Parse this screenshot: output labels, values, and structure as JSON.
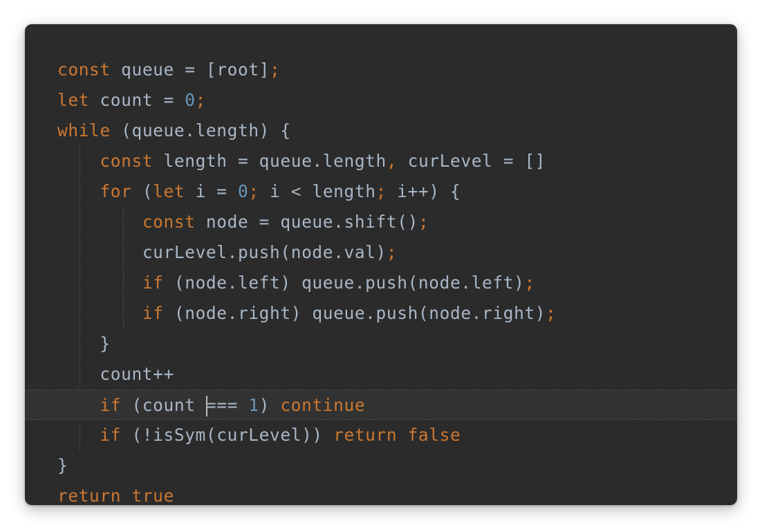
{
  "editor": {
    "lines": [
      {
        "indent": 0,
        "tokens": [
          {
            "t": "k",
            "v": "const"
          },
          {
            "t": "p",
            "v": " queue = [root]"
          },
          {
            "t": "k",
            "v": ";"
          }
        ]
      },
      {
        "indent": 0,
        "tokens": [
          {
            "t": "k",
            "v": "let"
          },
          {
            "t": "p",
            "v": " count = "
          },
          {
            "t": "n",
            "v": "0"
          },
          {
            "t": "k",
            "v": ";"
          }
        ]
      },
      {
        "indent": 0,
        "tokens": [
          {
            "t": "k",
            "v": "while"
          },
          {
            "t": "p",
            "v": " (queue.length) {"
          }
        ]
      },
      {
        "indent": 1,
        "tokens": [
          {
            "t": "k",
            "v": "const"
          },
          {
            "t": "p",
            "v": " length = queue.length"
          },
          {
            "t": "k",
            "v": ","
          },
          {
            "t": "p",
            "v": " curLevel = []"
          }
        ]
      },
      {
        "indent": 1,
        "tokens": [
          {
            "t": "k",
            "v": "for"
          },
          {
            "t": "p",
            "v": " ("
          },
          {
            "t": "k",
            "v": "let"
          },
          {
            "t": "p",
            "v": " i = "
          },
          {
            "t": "n",
            "v": "0"
          },
          {
            "t": "k",
            "v": ";"
          },
          {
            "t": "p",
            "v": " i < length"
          },
          {
            "t": "k",
            "v": ";"
          },
          {
            "t": "p",
            "v": " i++) {"
          }
        ]
      },
      {
        "indent": 2,
        "tokens": [
          {
            "t": "k",
            "v": "const"
          },
          {
            "t": "p",
            "v": " node = queue.shift()"
          },
          {
            "t": "k",
            "v": ";"
          }
        ]
      },
      {
        "indent": 2,
        "tokens": [
          {
            "t": "p",
            "v": "curLevel.push(node.val)"
          },
          {
            "t": "k",
            "v": ";"
          }
        ]
      },
      {
        "indent": 2,
        "tokens": [
          {
            "t": "k",
            "v": "if"
          },
          {
            "t": "p",
            "v": " (node.left) queue.push(node.left)"
          },
          {
            "t": "k",
            "v": ";"
          }
        ]
      },
      {
        "indent": 2,
        "tokens": [
          {
            "t": "k",
            "v": "if"
          },
          {
            "t": "p",
            "v": " (node.right) queue.push(node.right)"
          },
          {
            "t": "k",
            "v": ";"
          }
        ]
      },
      {
        "indent": 1,
        "tokens": [
          {
            "t": "p",
            "v": "}"
          }
        ]
      },
      {
        "indent": 1,
        "tokens": [
          {
            "t": "p",
            "v": "count++"
          }
        ]
      },
      {
        "indent": 1,
        "current": true,
        "tokens": [
          {
            "t": "k",
            "v": "if"
          },
          {
            "t": "p",
            "v": " (count "
          },
          {
            "t": "caret",
            "v": ""
          },
          {
            "t": "p",
            "v": "=== "
          },
          {
            "t": "n",
            "v": "1"
          },
          {
            "t": "p",
            "v": ") "
          },
          {
            "t": "k",
            "v": "continue"
          }
        ]
      },
      {
        "indent": 1,
        "tokens": [
          {
            "t": "k",
            "v": "if"
          },
          {
            "t": "p",
            "v": " (!isSym(curLevel)) "
          },
          {
            "t": "k",
            "v": "return false"
          }
        ]
      },
      {
        "indent": 0,
        "tokens": [
          {
            "t": "p",
            "v": "}"
          }
        ]
      },
      {
        "indent": 0,
        "tokens": [
          {
            "t": "k",
            "v": "return true"
          }
        ]
      }
    ],
    "colors": {
      "background": "#2b2b2b",
      "keyword": "#cc7832",
      "number": "#6897bb",
      "plain": "#a9b7c6",
      "current_line": "#323232"
    }
  }
}
